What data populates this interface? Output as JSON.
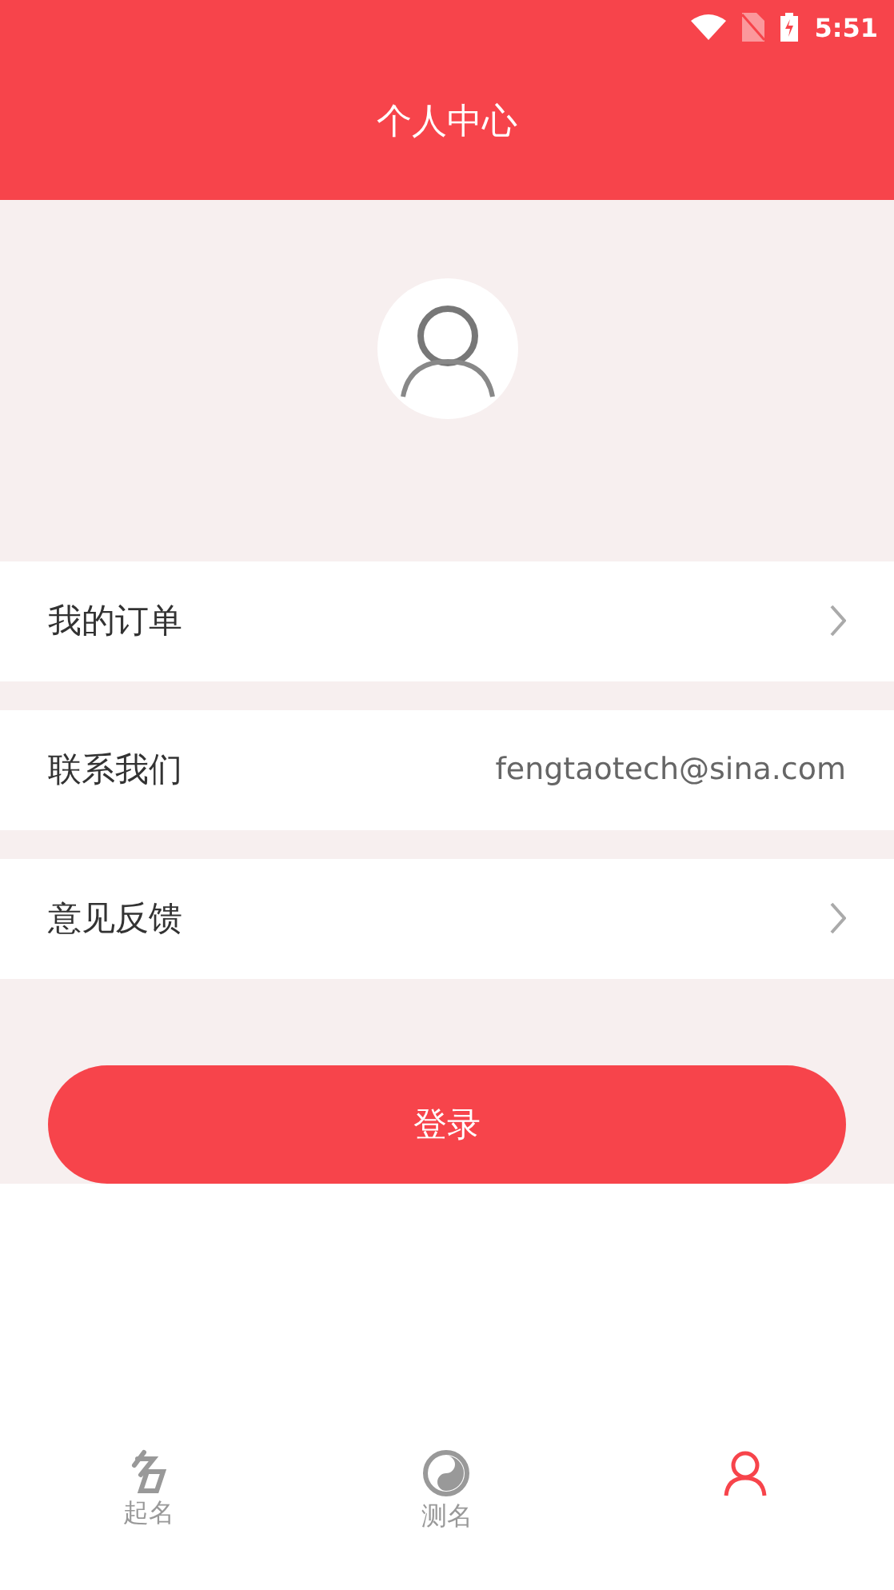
{
  "status_bar": {
    "time": "5:51"
  },
  "header": {
    "title": "个人中心"
  },
  "menu": [
    {
      "kind": "link",
      "label": "我的订单"
    },
    {
      "kind": "info",
      "label": "联系我们",
      "value": "fengtaotech@sina.com"
    },
    {
      "kind": "link",
      "label": "意见反馈"
    }
  ],
  "login_button": "登录",
  "tabs": [
    {
      "label": "起名",
      "selected": false
    },
    {
      "label": "测名",
      "selected": false
    },
    {
      "selected": true
    }
  ]
}
